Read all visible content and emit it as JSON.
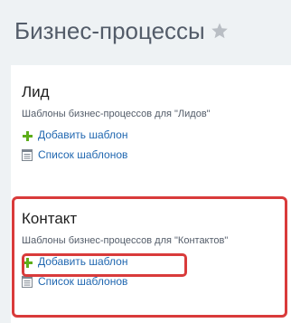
{
  "header": {
    "title": "Бизнес-процессы",
    "favorite_icon": "star-icon"
  },
  "colors": {
    "accent_link": "#2067b0",
    "add_icon": "#5eae1a",
    "highlight": "#d93b3b"
  },
  "sections": [
    {
      "title": "Лид",
      "description": "Шаблоны бизнес-процессов для \"Лидов\"",
      "add_label": "Добавить шаблон",
      "list_label": "Список шаблонов"
    },
    {
      "title": "Контакт",
      "description": "Шаблоны бизнес-процессов для \"Контактов\"",
      "add_label": "Добавить шаблон",
      "list_label": "Список шаблонов"
    }
  ]
}
